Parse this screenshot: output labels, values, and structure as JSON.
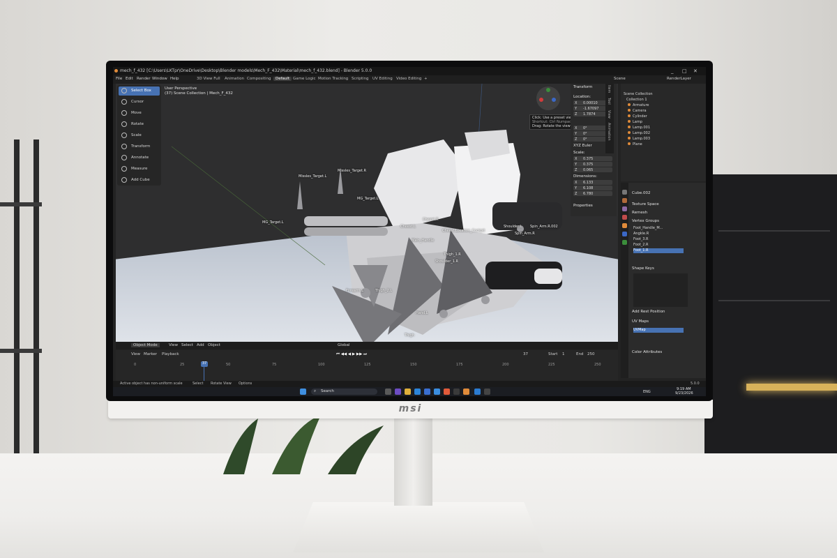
{
  "window": {
    "title": "mech_f_432 [C:\\Users\\LKTpr\\OneDrive\\Desktop\\Blender models\\Mech_F_432\\Material\\mech_f_432.blend] - Blender 5.0.0",
    "minimize": "_",
    "maximize": "□",
    "close": "✕"
  },
  "menu": {
    "items": [
      "File",
      "Edit",
      "Render",
      "Window",
      "Help"
    ],
    "workspaces": [
      "3D View Full",
      "Animation",
      "Compositing",
      "Default",
      "Game Logic",
      "Motion Tracking",
      "Scripting",
      "UV Editing",
      "Video Editing",
      "+"
    ],
    "active_workspace": "Default",
    "scene": "Scene",
    "view_layer": "RenderLayer"
  },
  "toolbar": {
    "tools": [
      "Select Box",
      "Cursor",
      "Move",
      "Rotate",
      "Scale",
      "Transform",
      "Annotate",
      "Measure",
      "Add Cube"
    ],
    "active": "Select Box"
  },
  "viewport": {
    "perspective": "User Perspective",
    "collection": "(37) Scene Collection | Mech_F_432",
    "tooltip_line1": "Click: Use a preset viewpoint",
    "tooltip_line2": "Shortcut: Ctrl Numpad 1",
    "tooltip_line3": "Drag: Rotate the view",
    "bone_labels": [
      "Missles_Target.L",
      "Missles_Target.R",
      "MG_Target.L",
      "MG_Target.L",
      "Cheest.L",
      "Cheest.R",
      "Cheest.Location_Cockpit",
      "Main_Handle",
      "Shoulder.L",
      "Spin_Arm.R.002",
      "Spin_Arm.R",
      "Forearm.L",
      "Thigh_2.L",
      "Thigh_1.R",
      "Shoulder_1.R",
      "Hand.L",
      "Thigh"
    ]
  },
  "npanel": {
    "header": "Transform",
    "location_label": "Location:",
    "loc": [
      {
        "axis": "X",
        "value": "0.00010"
      },
      {
        "axis": "Y",
        "value": "-1.67097"
      },
      {
        "axis": "Z",
        "value": "1.7874"
      }
    ],
    "rot": [
      {
        "axis": "X",
        "value": "0°"
      },
      {
        "axis": "Y",
        "value": "0°"
      },
      {
        "axis": "Z",
        "value": "0°"
      }
    ],
    "rot_mode": "XYZ Euler",
    "scale_label": "Scale:",
    "scale": [
      {
        "axis": "X",
        "value": "0.375"
      },
      {
        "axis": "Y",
        "value": "0.375"
      },
      {
        "axis": "Z",
        "value": "0.065"
      }
    ],
    "dims_label": "Dimensions:",
    "dims": [
      {
        "axis": "X",
        "value": "6.133"
      },
      {
        "axis": "Y",
        "value": "6.108"
      },
      {
        "axis": "Z",
        "value": "6.780"
      }
    ],
    "properties": "Properties",
    "tabs": [
      "Item",
      "Tool",
      "View",
      "Animation"
    ]
  },
  "header": {
    "mode": "Object Mode",
    "menus": [
      "View",
      "Select",
      "Add",
      "Object"
    ],
    "orientation": "Global"
  },
  "timeline": {
    "menus": [
      "View",
      "Marker",
      "Playback"
    ],
    "current_frame": "37",
    "start_label": "Start",
    "start": "1",
    "end_label": "End",
    "end": "250",
    "ticks": [
      "0",
      "25",
      "50",
      "75",
      "100",
      "125",
      "150",
      "175",
      "200",
      "225",
      "250"
    ]
  },
  "status": {
    "warning": "Active object has non-uniform scale",
    "select": "Select",
    "rotate": "Rotate View",
    "options": "Options",
    "version": "5.0.0"
  },
  "outliner": {
    "root": "Scene Collection",
    "collection": "Collection 1",
    "items": [
      "Armature",
      "Camera",
      "Cylinder",
      "Lamp",
      "Lamp.001",
      "Lamp.002",
      "Lamp.003",
      "Plane"
    ]
  },
  "properties": {
    "object": "Cube.002",
    "sections": [
      "Texture Space",
      "Remesh",
      "Vertex Groups",
      "Shape Keys",
      "UV Maps",
      "Color Attributes"
    ],
    "vertex_groups": [
      "Foot_Handle_M...",
      "Angkle.R",
      "Foot_3.R",
      "Foot_2.R",
      "Foot_1.R"
    ],
    "selected_group": "Foot_1.R",
    "add_rest": "Add Rest Position",
    "uv_map": "UVMap"
  },
  "taskbar": {
    "search": "Search",
    "lang": "ENG",
    "time": "9:19 AM",
    "date": "9/23/2026"
  },
  "monitor": {
    "brand": "msi"
  },
  "colors": {
    "accent": "#4772b3",
    "orange": "#e08b3a"
  }
}
